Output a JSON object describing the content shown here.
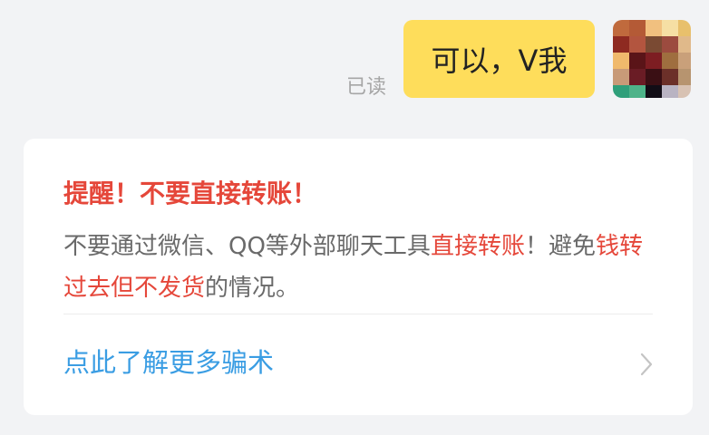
{
  "message": {
    "read_status": "已读",
    "text": "可以，V我"
  },
  "warning_card": {
    "title": "提醒！不要直接转账！",
    "body": {
      "part1": "不要通过微信、QQ等外部聊天工具",
      "part2": "直接转账",
      "part3": "！避免",
      "part4": "钱转过去但不发货",
      "part5": "的情况。"
    },
    "link_label": "点此了解更多骗术",
    "link_icon": "chevron-right-icon"
  },
  "colors": {
    "background": "#f2f3f5",
    "bubble": "#fedd5b",
    "warning_red": "#e5473a",
    "link_blue": "#3a9de3",
    "body_gray": "#6a6a6a"
  }
}
